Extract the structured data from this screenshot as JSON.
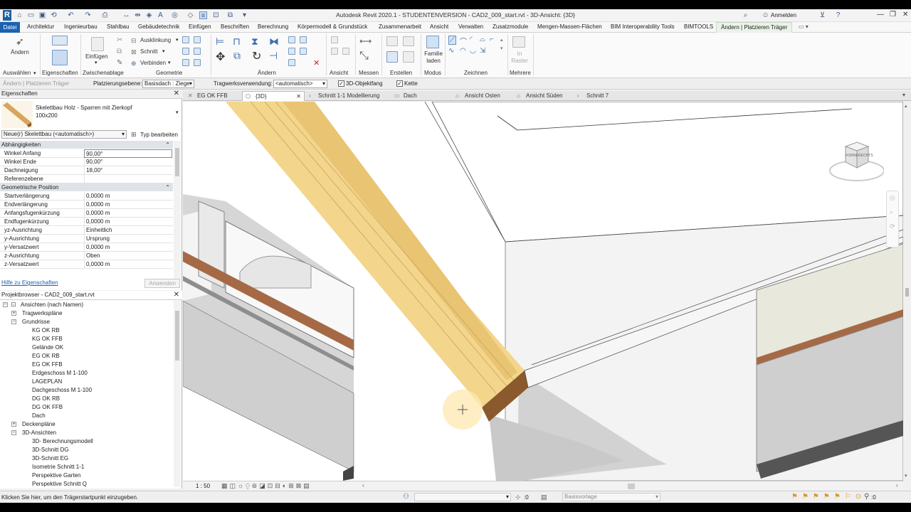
{
  "window": {
    "title": "Autodesk Revit 2020.1 - STUDENTENVERSION - CAD2_009_start.rvt - 3D-Ansicht: {3D}",
    "sign_in": "Anmelden"
  },
  "ribbon_tabs": [
    "Datei",
    "Architektur",
    "Ingenieurbau",
    "Stahlbau",
    "Gebäudetechnik",
    "Einfügen",
    "Beschriften",
    "Berechnung",
    "Körpermodell & Grundstück",
    "Zusammenarbeit",
    "Ansicht",
    "Verwalten",
    "Zusatzmodule",
    "Mengen-Massen-Flächen",
    "BIM Interoperability Tools",
    "BIMTOOLS",
    "Ändern | Platzieren Träger"
  ],
  "ribbon": {
    "aendern": "Ändern",
    "einfuegen": "Einfügen",
    "ausklinkung": "Ausklinkung",
    "schnitt": "Schnitt",
    "verbinden": "Verbinden",
    "familie_laden": "Familie laden",
    "in_raster": "In Raster",
    "groups": {
      "auswaehlen": "Auswählen",
      "eigenschaften": "Eigenschaften",
      "zwischenablage": "Zwischenablage",
      "geometrie": "Geometrie",
      "aendern": "Ändern",
      "ansicht": "Ansicht",
      "messen": "Messen",
      "erstellen": "Erstellen",
      "modus": "Modus",
      "zeichnen": "Zeichnen",
      "mehrere": "Mehrere"
    }
  },
  "options_bar": {
    "context": "Ändern | Platzieren Träger",
    "placement_label": "Platzierungsebene:",
    "placement_value": "Basisdach : Ziege",
    "usage_label": "Tragwerksverwendung:",
    "usage_value": "<automatisch>",
    "snap_label": "3D-Objektfang",
    "chain_label": "Kette"
  },
  "properties": {
    "title": "Eigenschaften",
    "type_name": "Skelettbau Holz - Sparren mit Zierkopf",
    "type_size": "100x200",
    "instance_selector": "Neue(r) Skelettbau (<automatisch>)",
    "edit_type": "Typ bearbeiten",
    "categories": [
      {
        "name": "Abhängigkeiten",
        "rows": [
          {
            "k": "Winkel Anfang",
            "v": "90,00°"
          },
          {
            "k": "Winkel Ende",
            "v": "90,00°"
          },
          {
            "k": "Dachneigung",
            "v": "18,00°"
          },
          {
            "k": "Referenzebene",
            "v": ""
          }
        ]
      },
      {
        "name": "Geometrische Position",
        "rows": [
          {
            "k": "Startverlängerung",
            "v": "0,0000 m"
          },
          {
            "k": "Endverlängerung",
            "v": "0,0000 m"
          },
          {
            "k": "Anfangsfugenkürzung",
            "v": "0,0000 m"
          },
          {
            "k": "Endfugenkürzung",
            "v": "0,0000 m"
          },
          {
            "k": "yz-Ausrichtung",
            "v": "Einheitlich"
          },
          {
            "k": "y-Ausrichtung",
            "v": "Ursprung"
          },
          {
            "k": "y-Versatzwert",
            "v": "0,0000 m"
          },
          {
            "k": "z-Ausrichtung",
            "v": "Oben"
          },
          {
            "k": "z-Versatzwert",
            "v": "0,0000 m"
          }
        ]
      }
    ],
    "help_link": "Hilfe zu Eigenschaften",
    "apply": "Anwenden"
  },
  "browser": {
    "title": "Projektbrowser - CAD2_009_start.rvt",
    "root": "Ansichten (nach Namen)",
    "tragwerksplaene": "Tragwerkspläne",
    "grundrisse": "Grundrisse",
    "grundriss_items": [
      "KG OK RB",
      "KG OK FFB",
      "Gelände OK",
      "EG OK RB",
      "EG OK FFB",
      "Erdgeschoss M 1-100",
      "LAGEPLAN",
      "Dachgeschoss M 1-100",
      "DG OK RB",
      "DG OK FFB",
      "Dach"
    ],
    "deckenplaene": "Deckenpläne",
    "ansichten3d": "3D-Ansichten",
    "ansichten3d_items": [
      "3D- Berechnungsmodell",
      "3D-Schnitt DG",
      "3D-Schnitt EG",
      "Isometrie Schnitt 1-1",
      "Perspektive Garten",
      "Perspektive Schnitt Q"
    ]
  },
  "view_tabs": [
    "EG OK FFB",
    "{3D}",
    "Schnitt 1-1 Modellierung",
    "Dach",
    "Ansicht Osten",
    "Ansicht Süden",
    "Schnitt 7"
  ],
  "view_bar": {
    "scale": "1 : 50"
  },
  "status": {
    "message": "Klicken Sie hier, um den Trägerstartpunkt einzugeben.",
    "count": ":0",
    "template": "Basisvorlage",
    "filter": ":0"
  },
  "viewcube": {
    "front": "VORNE",
    "right": "RECHTS"
  },
  "colors": {
    "accent": "#1a62b0",
    "beam": "#f3d58c",
    "beam_end": "#8a5a2c"
  }
}
